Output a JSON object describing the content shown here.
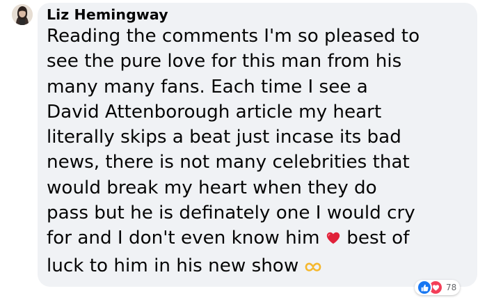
{
  "comment": {
    "author": "Liz Hemingway",
    "lines": [
      "Reading the comments I'm so pleased to",
      "see the pure love for this man from his",
      "many many fans. Each time I see a",
      "David Attenborough article my heart",
      "literally skips a beat just incase its bad",
      "news, there is not many celebrities that",
      "would break my heart when they do",
      "pass but he is definately one I would cry"
    ],
    "line9_before_emoji": "for and I don't even know him ",
    "line9_after_emoji": " best of",
    "line10": "luck to him in his new show ",
    "emojis": {
      "heart": "red-heart-icon",
      "hands": "heart-hands-icon"
    }
  },
  "reactions": {
    "count": "78",
    "types": [
      "like-icon",
      "love-icon"
    ],
    "colors": {
      "like": "#1877f2",
      "love": "#f33e58"
    }
  },
  "colors": {
    "bubble": "#f0f2f5",
    "text": "#050505",
    "meta": "#65676b"
  }
}
